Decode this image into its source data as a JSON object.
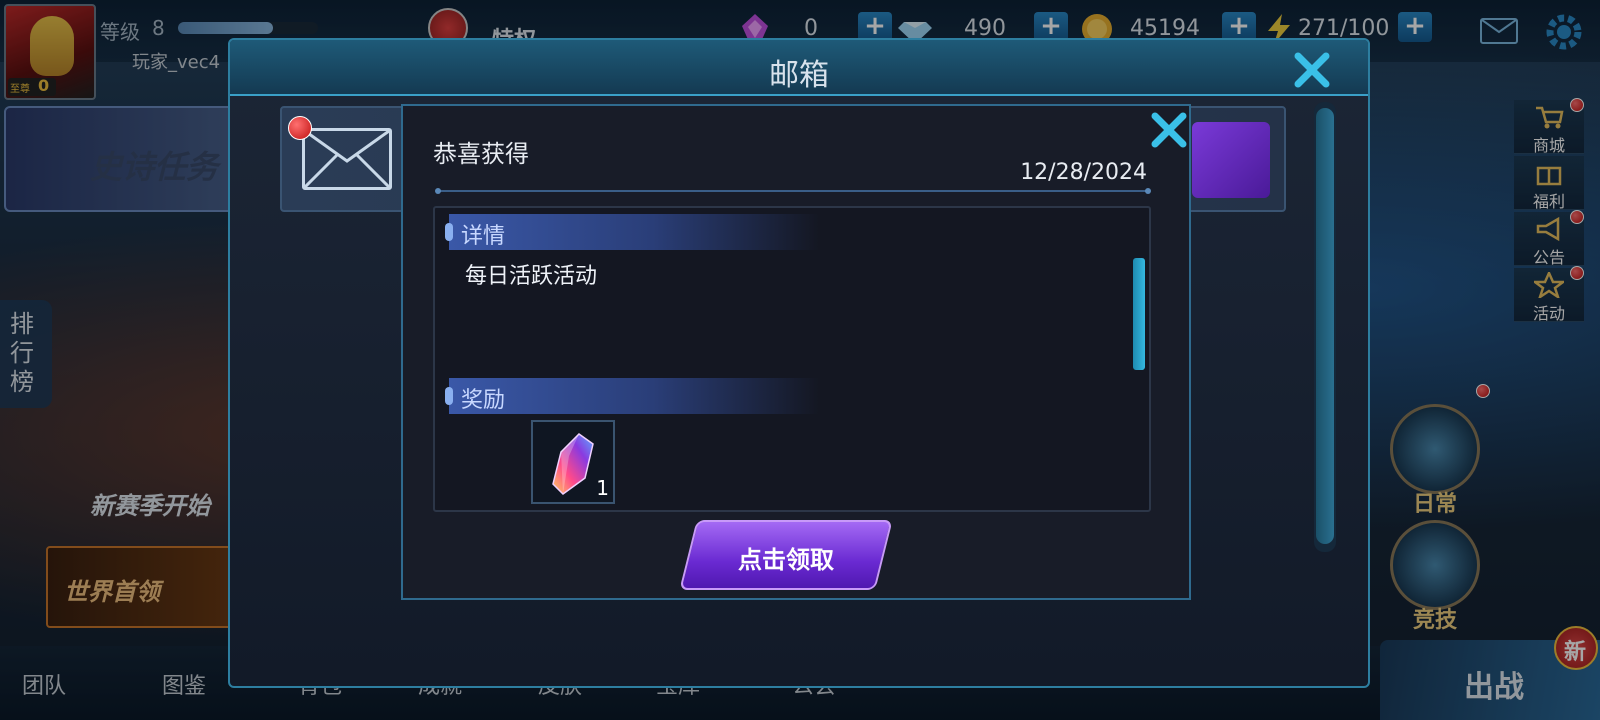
{
  "topbar": {
    "level_label": "等级",
    "level_value": "8",
    "xp_fraction": 0.68,
    "player_name": "玩家_vec4",
    "vip_label": "至尊",
    "vip_level": "0",
    "privilege_label": "特权",
    "currencies": [
      {
        "name": "gem-shard",
        "value": "0"
      },
      {
        "name": "diamond",
        "value": "490"
      },
      {
        "name": "gold-coin",
        "value": "45194"
      },
      {
        "name": "energy",
        "value": "271/100"
      }
    ],
    "plus_label": "+"
  },
  "left_panel": {
    "epic_quest_label": "史诗任务",
    "ranking_label": "排行榜",
    "new_season_label": "新赛季开始",
    "world_boss_label": "世界首领"
  },
  "bottombar": {
    "items": [
      "团队",
      "图鉴",
      "背包",
      "成就",
      "皮肤",
      "宝库",
      "公会"
    ],
    "battle_label": "出战",
    "new_badge_label": "新"
  },
  "right_menu": {
    "items": [
      {
        "label": "商城",
        "icon": "cart-icon"
      },
      {
        "label": "福利",
        "icon": "gift-icon"
      },
      {
        "label": "公告",
        "icon": "megaphone-icon"
      },
      {
        "label": "活动",
        "icon": "star-icon"
      }
    ],
    "emblems": [
      {
        "label": "日常"
      },
      {
        "label": "竞技"
      }
    ]
  },
  "mailbox": {
    "title": "邮箱"
  },
  "detail": {
    "subject": "恭喜获得",
    "date": "12/28/2024",
    "details_header": "详情",
    "details_text": "每日活跃活动",
    "rewards_header": "奖励",
    "reward_quantity": "1",
    "reward_icon": "crystal-icon",
    "claim_label": "点击领取"
  },
  "colors": {
    "accent_teal": "#2d7ea0",
    "claim_purple": "#7a3ad8",
    "section_blue": "#3a58a8",
    "notification_red": "#c01010"
  }
}
